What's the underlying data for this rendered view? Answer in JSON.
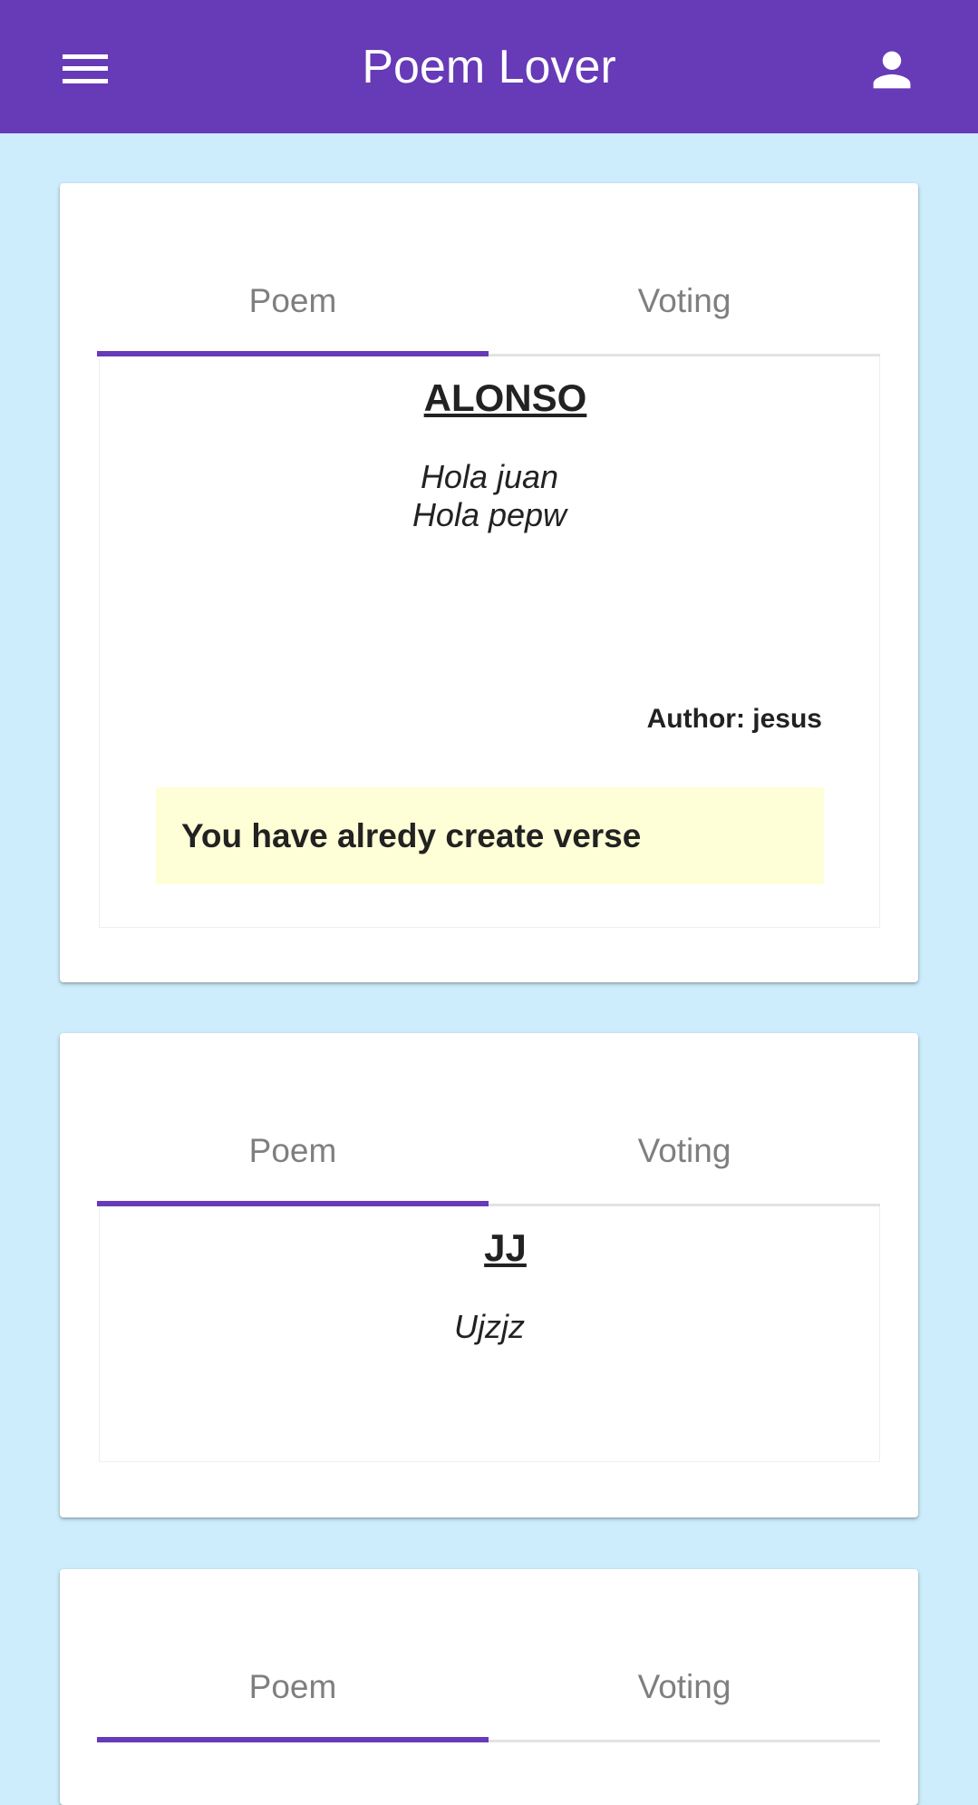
{
  "app": {
    "title": "Poem Lover",
    "accent_color": "#673ab7",
    "background_color": "#cdedfc",
    "menu_icon": "hamburger-menu-icon",
    "account_icon": "account-icon"
  },
  "cards": [
    {
      "tabs": [
        {
          "label": "Poem",
          "selected": true
        },
        {
          "label": "Voting",
          "selected": false
        }
      ],
      "poem": {
        "title": "ALONSO",
        "verses": [
          "Hola juan",
          "Hola pepw"
        ],
        "author": "Author: jesus"
      },
      "notice": "You have alredy create verse",
      "notice_color": "#feffd6"
    },
    {
      "tabs": [
        {
          "label": "Poem",
          "selected": true
        },
        {
          "label": "Voting",
          "selected": false
        }
      ],
      "poem": {
        "title": "JJ",
        "verses": [
          "Ujzjz"
        ]
      }
    },
    {
      "tabs": [
        {
          "label": "Poem",
          "selected": true
        },
        {
          "label": "Voting",
          "selected": false
        }
      ]
    }
  ]
}
